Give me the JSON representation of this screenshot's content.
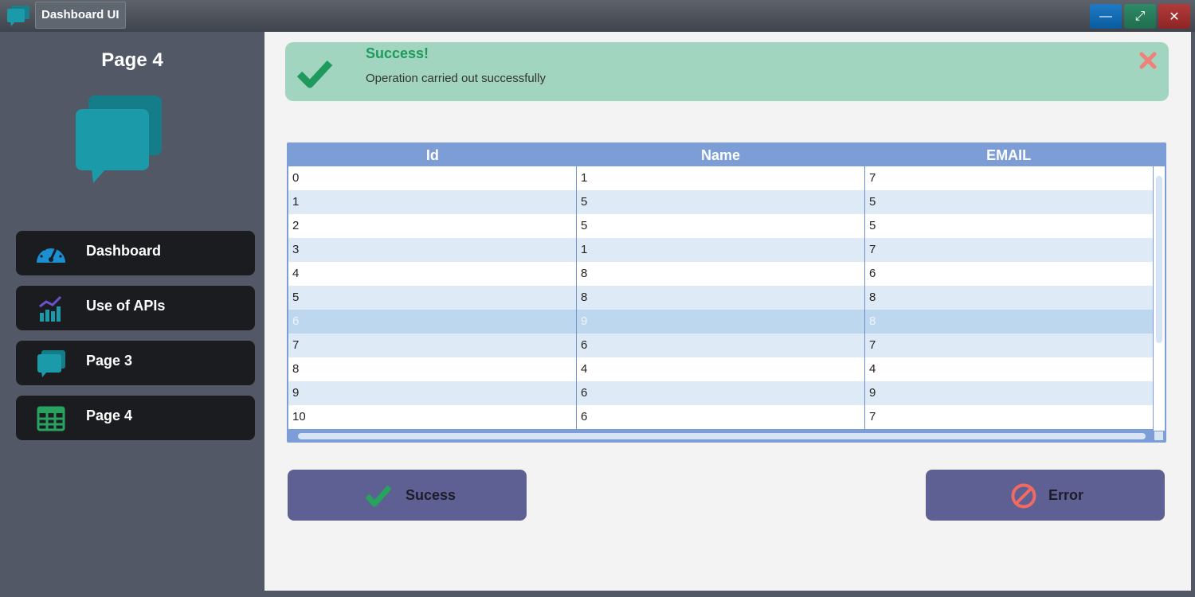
{
  "window": {
    "title": "Dashboard UI",
    "controls": {
      "minimize": "—",
      "maximize": "⤢",
      "close": "✕"
    }
  },
  "sidebar": {
    "title": "Page 4",
    "header_icon": "chat-bubbles-icon",
    "items": [
      {
        "label": "Dashboard",
        "icon": "speedometer-icon"
      },
      {
        "label": "Use of APIs",
        "icon": "bar-chart-icon"
      },
      {
        "label": "Page 3",
        "icon": "chat-bubbles-icon"
      },
      {
        "label": "Page 4",
        "icon": "table-grid-icon"
      }
    ]
  },
  "alert": {
    "title": "Success!",
    "message": "Operation carried out successfully",
    "icon": "checkmark-icon",
    "close_icon": "close-icon",
    "colors": {
      "background": "#a1d5bf",
      "title": "#1f9a5c",
      "close": "#f0817a"
    }
  },
  "table": {
    "columns": [
      "Id",
      "Name",
      "EMAIL"
    ],
    "selected_row_index": 6,
    "rows": [
      [
        "0",
        "1",
        "7"
      ],
      [
        "1",
        "5",
        "5"
      ],
      [
        "2",
        "5",
        "5"
      ],
      [
        "3",
        "1",
        "7"
      ],
      [
        "4",
        "8",
        "6"
      ],
      [
        "5",
        "8",
        "8"
      ],
      [
        "6",
        "9",
        "8"
      ],
      [
        "7",
        "6",
        "7"
      ],
      [
        "8",
        "4",
        "4"
      ],
      [
        "9",
        "6",
        "9"
      ],
      [
        "10",
        "6",
        "7"
      ]
    ]
  },
  "buttons": {
    "success": {
      "label": "Sucess",
      "icon": "checkmark-icon"
    },
    "error": {
      "label": "Error",
      "icon": "prohibited-icon"
    }
  },
  "colors": {
    "accent_teal": "#1b9aaa",
    "success_green": "#27a35f",
    "error_red": "#ee6a63",
    "button_purple": "#5e5f92",
    "table_header": "#7c9dd6"
  }
}
